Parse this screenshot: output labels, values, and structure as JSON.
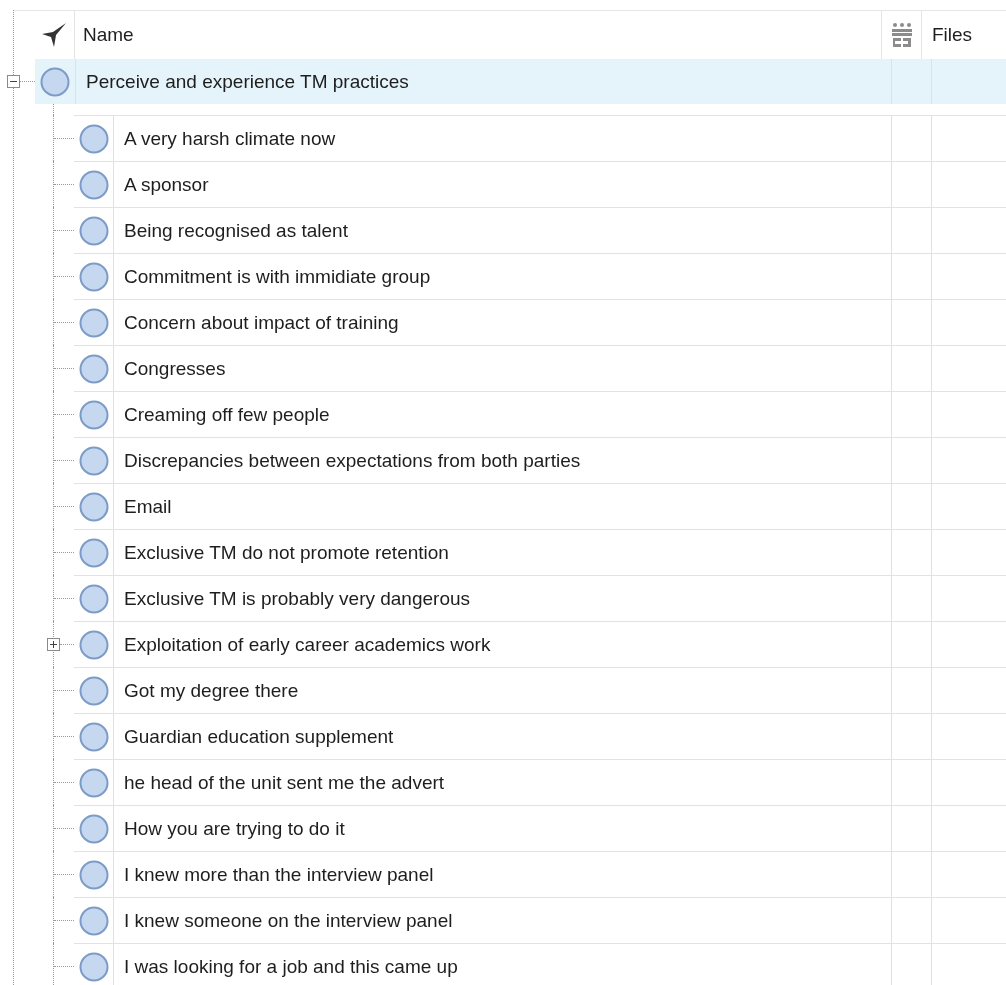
{
  "columns": [
    {
      "label": "Name"
    },
    {
      "label": "Files"
    }
  ],
  "nodes": [
    {
      "name": "Perceive and experience TM practices",
      "selected": true,
      "expanded": true,
      "children": [
        {
          "name": "A very harsh climate now",
          "selected": false,
          "expandable": false
        },
        {
          "name": "A sponsor",
          "selected": false,
          "expandable": false
        },
        {
          "name": "Being recognised as talent",
          "selected": false,
          "expandable": false
        },
        {
          "name": "Commitment is with immidiate group",
          "selected": false,
          "expandable": false
        },
        {
          "name": "Concern about impact of training",
          "selected": false,
          "expandable": false
        },
        {
          "name": "Congresses",
          "selected": false,
          "expandable": false
        },
        {
          "name": "Creaming off few people",
          "selected": false,
          "expandable": false
        },
        {
          "name": "Discrepancies between expectations from both parties",
          "selected": false,
          "expandable": false
        },
        {
          "name": "Email",
          "selected": false,
          "expandable": false
        },
        {
          "name": "Exclusive TM do not promote retention",
          "selected": false,
          "expandable": false
        },
        {
          "name": "Exclusive TM is probably very dangerous",
          "selected": false,
          "expandable": false
        },
        {
          "name": "Exploitation of early career academics work",
          "selected": false,
          "expandable": true
        },
        {
          "name": "Got my degree there",
          "selected": false,
          "expandable": false
        },
        {
          "name": "Guardian education supplement",
          "selected": false,
          "expandable": false
        },
        {
          "name": "he head of the unit sent me the advert",
          "selected": false,
          "expandable": false
        },
        {
          "name": "How you are trying to do it",
          "selected": false,
          "expandable": false
        },
        {
          "name": "I knew more than the interview panel",
          "selected": false,
          "expandable": false
        },
        {
          "name": "I knew someone on the interview panel",
          "selected": false,
          "expandable": false
        },
        {
          "name": "I was looking for a job and this came up",
          "selected": false,
          "expandable": false
        }
      ]
    }
  ]
}
